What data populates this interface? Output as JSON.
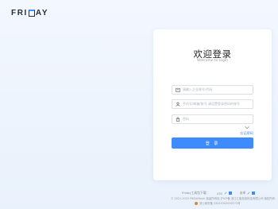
{
  "logo": {
    "text_left": "FRI",
    "text_right": "AY"
  },
  "card": {
    "title": "欢迎登录",
    "subtitle": "Welcome to login",
    "fields": {
      "account_placeholder": "请输入企业账号/代码",
      "user_placeholder": "手机号/邮箱/账号 请设置登录密码的账号",
      "password_placeholder": "密码"
    },
    "forgot_label": "忘记密码",
    "login_label": "登 录"
  },
  "footer": {
    "download_label": "Friday工具包下载：",
    "ios_label": "iOS",
    "android_label": "安卓",
    "copyright": "© 2021-2023 FRIDAYtech 保留所有权 沪ICP备 浙江汇客信息科技有限公司 版权所有",
    "icp": "浙公网安备 33010202000273号"
  },
  "colors": {
    "accent": "#3d8bfd",
    "bg": "#eef4fd"
  }
}
